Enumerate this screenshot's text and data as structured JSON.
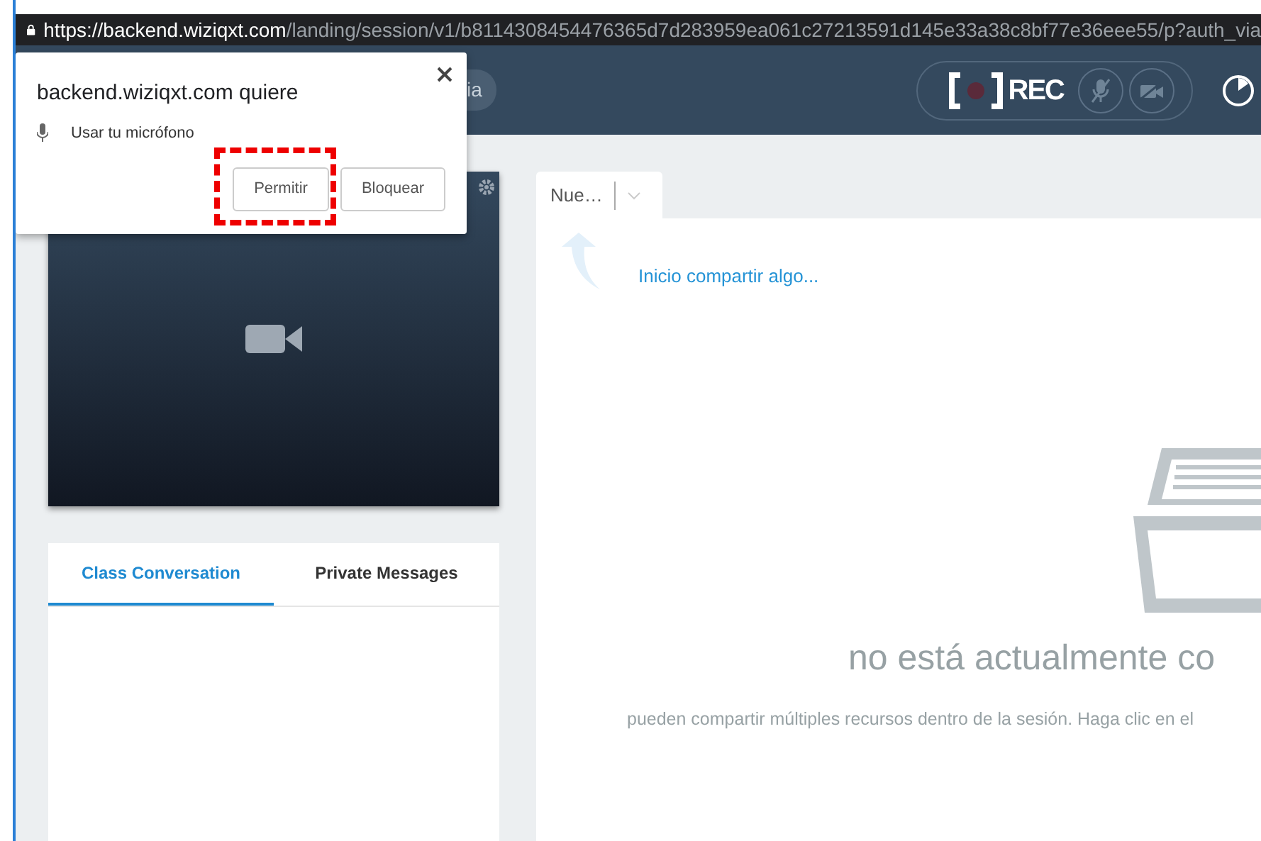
{
  "address_bar": {
    "secure": true,
    "origin": "https://backend.wiziqxt.com",
    "path": "/landing/session/v1/b8114308454476365d7d283959ea061c27213591d145e33a38c8bf77e36eee55/p?auth_via"
  },
  "permission_popup": {
    "title": "backend.wiziqxt.com quiere",
    "permission": "Usar tu micrófono",
    "buttons": [
      {
        "label": "Permitir",
        "highlighted": true
      },
      {
        "label": "Bloquear",
        "highlighted": false
      }
    ]
  },
  "header": {
    "pill_text": "ia",
    "record_label": "REC",
    "mic_muted": true,
    "camera_muted": true
  },
  "chat_tabs": [
    {
      "label": "Class Conversation",
      "selected": true
    },
    {
      "label": "Private Messages",
      "selected": false
    }
  ],
  "content_tab": {
    "label": "Nue…"
  },
  "content": {
    "hint": "Inicio compartir algo...",
    "empty_title": "no está actualmente co",
    "empty_text": "pueden compartir múltiples recursos dentro de la sesión. Haga clic en el"
  }
}
